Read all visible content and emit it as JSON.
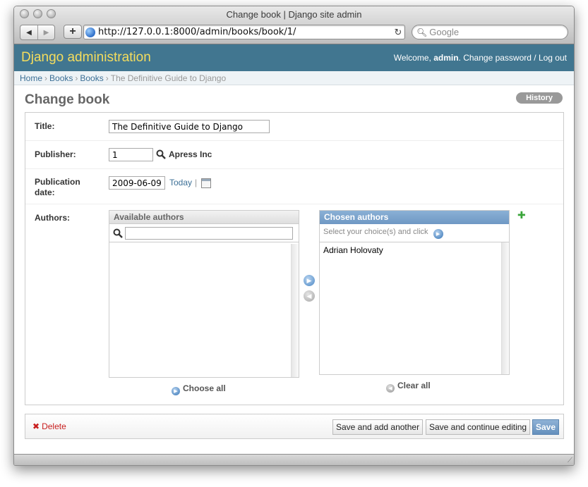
{
  "window": {
    "title": "Change book | Django site admin",
    "url": "http://127.0.0.1:8000/admin/books/book/1/",
    "search_placeholder": "Google"
  },
  "header": {
    "brand": "Django administration",
    "welcome": "Welcome, ",
    "username": "admin",
    "change_password": "Change password",
    "separator": " / ",
    "logout": "Log out"
  },
  "breadcrumbs": {
    "items": [
      "Home",
      "Books",
      "Books"
    ],
    "current": "The Definitive Guide to Django",
    "separator": "›"
  },
  "page": {
    "title": "Change book",
    "history": "History"
  },
  "form": {
    "title_label": "Title:",
    "title_value": "The Definitive Guide to Django",
    "publisher_label": "Publisher:",
    "publisher_id": "1",
    "publisher_name": "Apress Inc",
    "pubdate_label_1": "Publication",
    "pubdate_label_2": "date:",
    "pubdate_value": "2009-06-09",
    "today": "Today",
    "today_sep": "|",
    "authors_label": "Authors:"
  },
  "selector": {
    "available_title": "Available authors",
    "chosen_title": "Chosen authors",
    "chosen_help": "Select your choice(s) and click",
    "chosen_items": [
      "Adrian Holovaty"
    ],
    "choose_all": "Choose all",
    "clear_all": "Clear all",
    "add_symbol": "✚"
  },
  "submit": {
    "delete": "Delete",
    "save_add_another": "Save and add another",
    "save_continue": "Save and continue editing",
    "save": "Save"
  },
  "colors": {
    "header_bg": "#417690",
    "brand": "#f5dd5d",
    "link": "#3b6f96",
    "delete": "#c81e1e"
  }
}
